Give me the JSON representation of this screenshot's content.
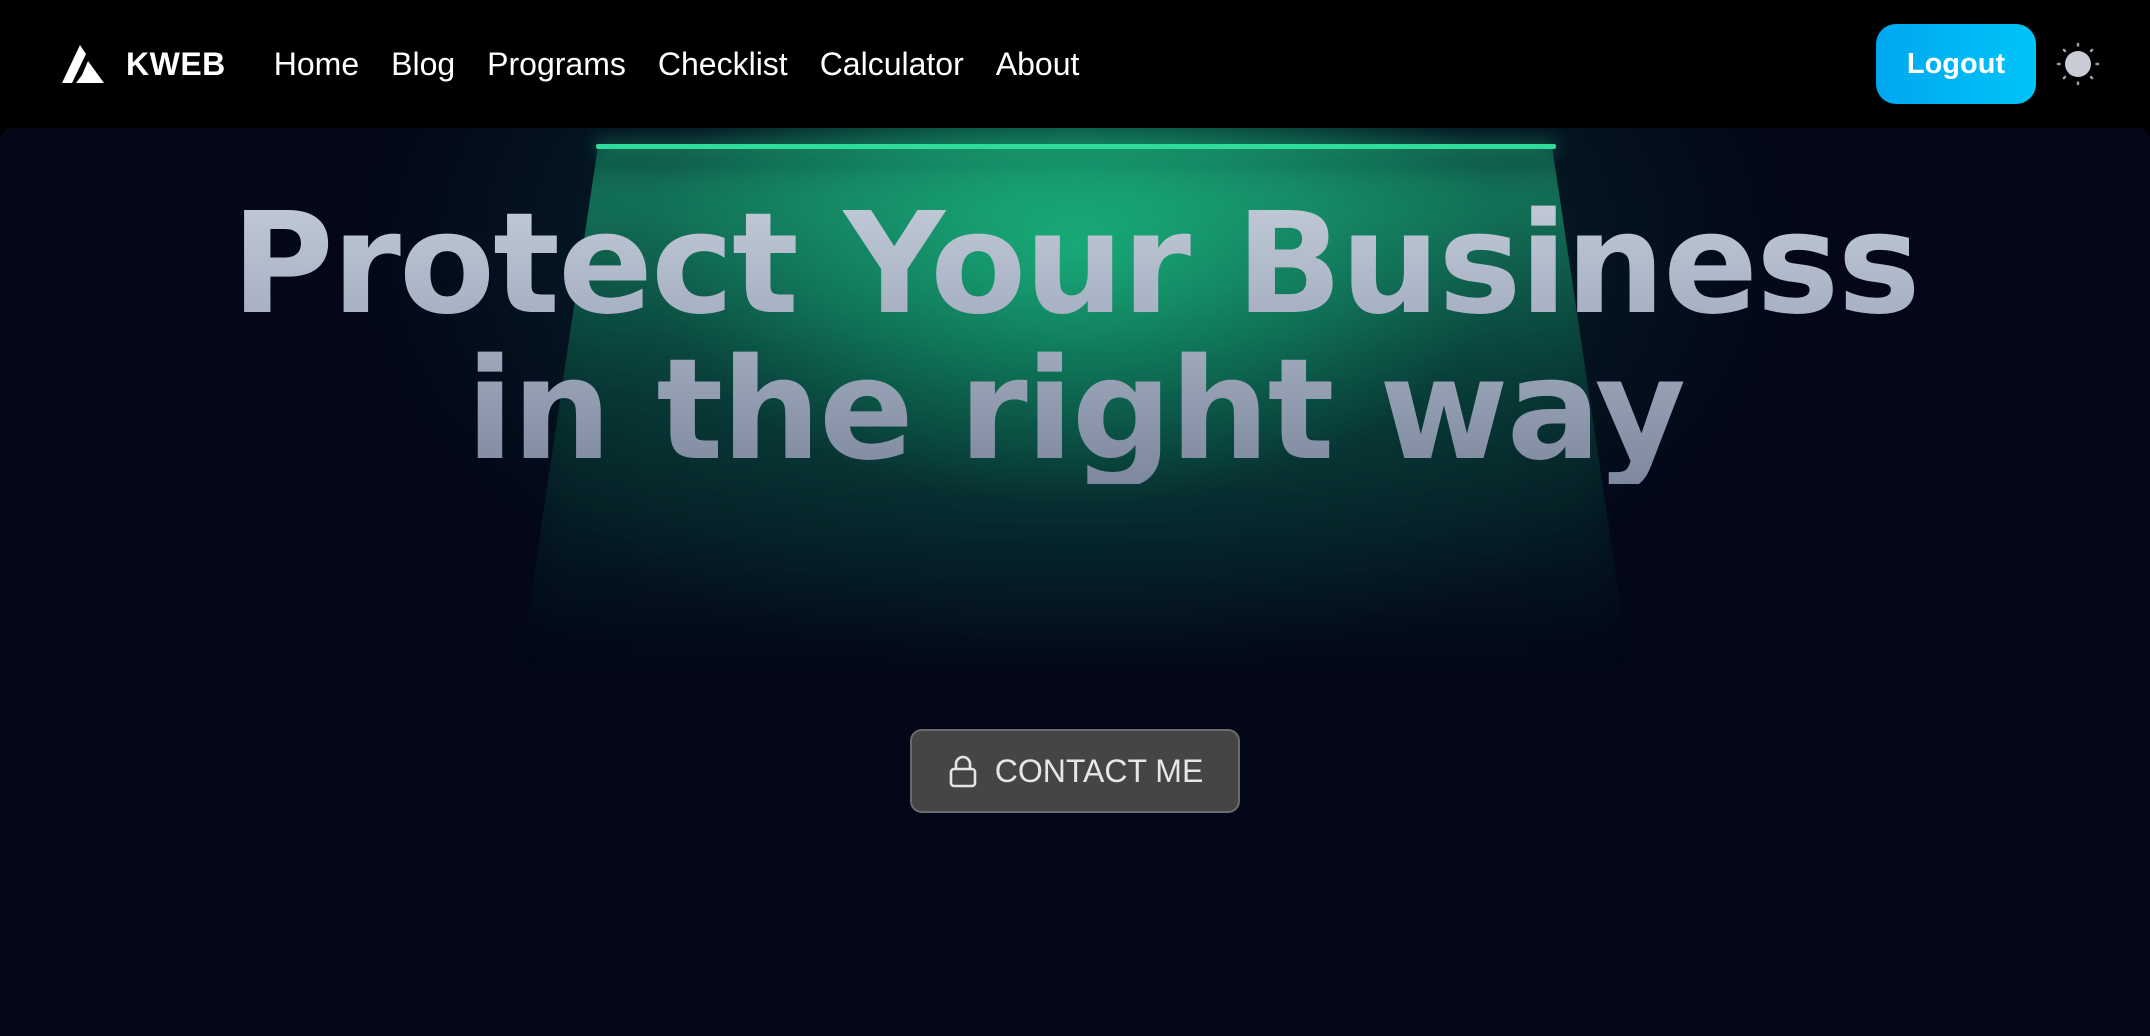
{
  "brand": {
    "name": "KWEB",
    "icon": "kweb-logo-icon"
  },
  "nav": {
    "links": [
      {
        "label": "Home"
      },
      {
        "label": "Blog"
      },
      {
        "label": "Programs"
      },
      {
        "label": "Checklist"
      },
      {
        "label": "Calculator"
      },
      {
        "label": "About"
      }
    ]
  },
  "header_actions": {
    "logout_label": "Logout",
    "theme_icon": "sun-icon"
  },
  "hero": {
    "headline_line1": "Protect Your Business",
    "headline_line2": "in the right way",
    "cta_label": "CONTACT ME",
    "cta_icon": "lock-icon"
  },
  "colors": {
    "background": "#030717",
    "navbar": "#000000",
    "accent_green": "#2fdc9a",
    "logout_button": "#00b8f3",
    "cta_button": "#454545"
  }
}
